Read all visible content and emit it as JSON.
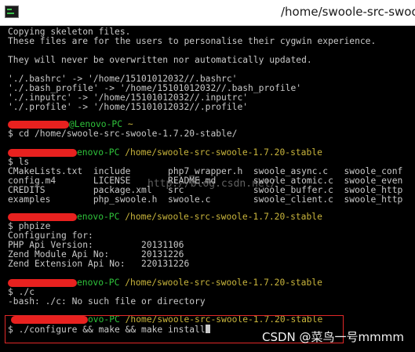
{
  "window": {
    "title": "/home/swoole-src-swoo"
  },
  "colors": {
    "green": "#2fc33b",
    "yellow": "#c9b53c",
    "text": "#c9c9c9",
    "redaction": "#e8211f",
    "highlight": "#e02828"
  },
  "output": {
    "skeleton": [
      "Copying skeleton files.",
      "These files are for the users to personalise their cygwin experience.",
      "",
      "They will never be overwritten nor automatically updated.",
      "",
      "'./.bashrc' -> '/home/15101012032//.bashrc'",
      "'./.bash_profile' -> '/home/15101012032//.bash_profile'",
      "'./.inputrc' -> '/home/15101012032//.inputrc'",
      "'./.profile' -> '/home/15101012032//.profile'"
    ],
    "ls_rows": [
      "CMakeLists.txt  include       php7_wrapper.h  swoole_async.c   swoole_conf",
      "config.m4       LICENSE       README.md       swoole_atomic.c  swoole_even",
      "CREDITS         package.xml   src             swoole_buffer.c  swoole_http",
      "examples        php_swoole.h  swoole.c        swoole_client.c  swoole_http"
    ],
    "phpize": [
      "Configuring for:",
      "PHP Api Version:         20131106",
      "Zend Module Api No:      20131226",
      "Zend Extension Api No:   220131226"
    ],
    "error": "-bash: ./c: No such file or directory"
  },
  "prompts": [
    {
      "user": "@Lenovo-PC",
      "path": "~",
      "command": "$ cd /home/swoole-src-swoole-1.7.20-stable/"
    },
    {
      "user": "enovo-PC",
      "path": "/home/swoole-src-swoole-1.7.20-stable",
      "command": "$ ls"
    },
    {
      "user": "enovo-PC",
      "path": "/home/swoole-src-swoole-1.7.20-stable",
      "command": "$ phpize"
    },
    {
      "user": "enovo-PC",
      "path": "/home/swoole-src-swoole-1.7.20-stable",
      "command": "$ ./c"
    },
    {
      "user": "ovo-PC",
      "path": "/home/swoole-src-swoole-1.7.20-stable",
      "command": "$ ./configure && make && make install"
    }
  ],
  "watermark": {
    "url": "http://blog.csdn.net/",
    "credit": "CSDN @菜鸟一号mmmm"
  }
}
